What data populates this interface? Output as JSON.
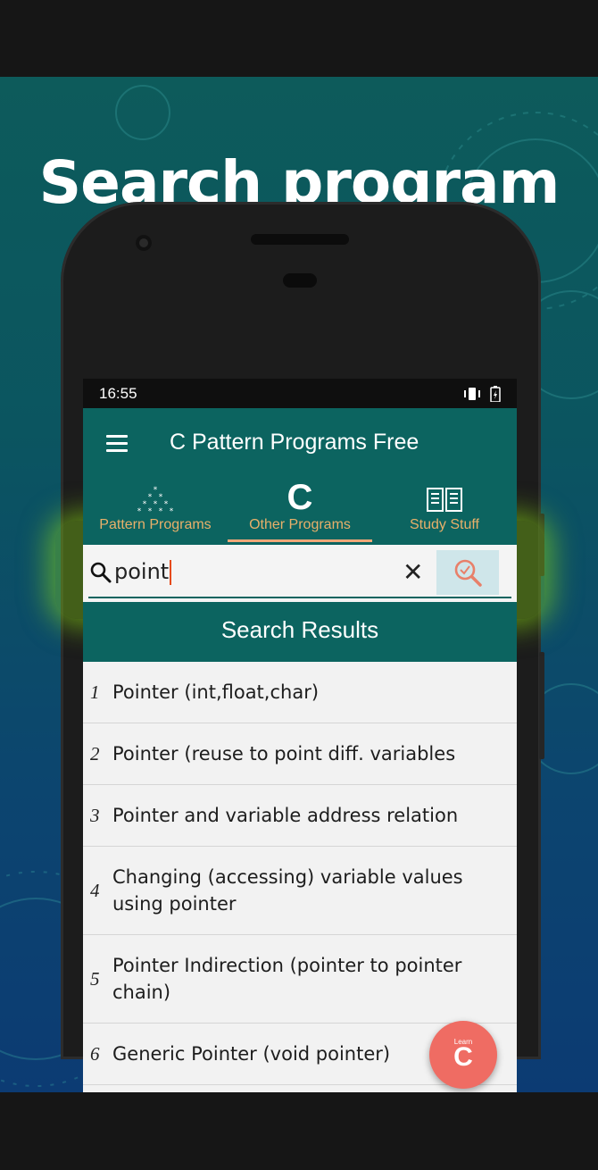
{
  "promo": {
    "headline": "Search program"
  },
  "status_bar": {
    "time": "16:55"
  },
  "app_bar": {
    "title": "C Pattern Programs Free"
  },
  "tabs": [
    {
      "label": "Pattern Programs",
      "icon": "star-pyramid-icon",
      "active": false
    },
    {
      "label": "Other Programs",
      "icon": "letter-c",
      "glyph": "C",
      "active": true
    },
    {
      "label": "Study Stuff",
      "icon": "open-book-icon",
      "active": false
    }
  ],
  "search": {
    "value": "point",
    "clear_glyph": "✕"
  },
  "results": {
    "heading": "Search Results",
    "items": [
      {
        "num": "1",
        "text": "Pointer (int,float,char)"
      },
      {
        "num": "2",
        "text": "Pointer (reuse to point diff. variables"
      },
      {
        "num": "3",
        "text": "Pointer and variable address relation"
      },
      {
        "num": "4",
        "text": "Changing (accessing) variable values using pointer"
      },
      {
        "num": "5",
        "text": "Pointer Indirection (pointer to pointer chain)"
      },
      {
        "num": "6",
        "text": "Generic Pointer (void pointer)"
      }
    ]
  },
  "fab": {
    "small": "Learn",
    "big": "C"
  },
  "colors": {
    "app_bar": "#0c6460",
    "tab_label": "#e8b06a",
    "accent": "#f0a879",
    "fab": "#ef6c63",
    "glow": "#8cdc14"
  }
}
